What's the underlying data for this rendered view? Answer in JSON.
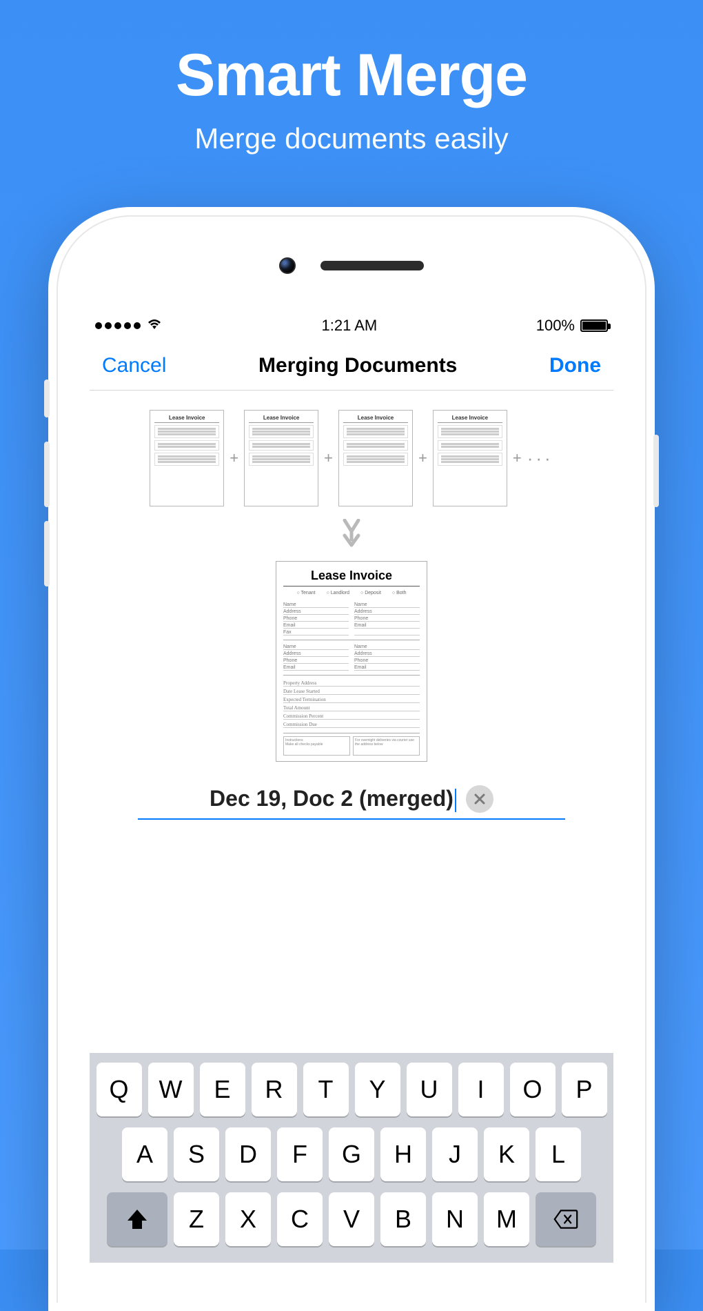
{
  "hero": {
    "title": "Smart Merge",
    "subtitle": "Merge documents easily"
  },
  "statusbar": {
    "time": "1:21 AM",
    "battery_pct": "100%"
  },
  "nav": {
    "cancel": "Cancel",
    "title": "Merging Documents",
    "done": "Done"
  },
  "thumbnails": {
    "doc_label": "Lease Invoice",
    "more": "···"
  },
  "result": {
    "title": "Lease Invoice",
    "checks": [
      "Tenant",
      "Landlord",
      "Deposit",
      "Both"
    ]
  },
  "rename": {
    "value": "Dec 19, Doc 2 (merged)"
  },
  "keyboard": {
    "row1": [
      "Q",
      "W",
      "E",
      "R",
      "T",
      "Y",
      "U",
      "I",
      "O",
      "P"
    ],
    "row2": [
      "A",
      "S",
      "D",
      "F",
      "G",
      "H",
      "J",
      "K",
      "L"
    ],
    "row3": [
      "Z",
      "X",
      "C",
      "V",
      "B",
      "N",
      "M"
    ]
  }
}
